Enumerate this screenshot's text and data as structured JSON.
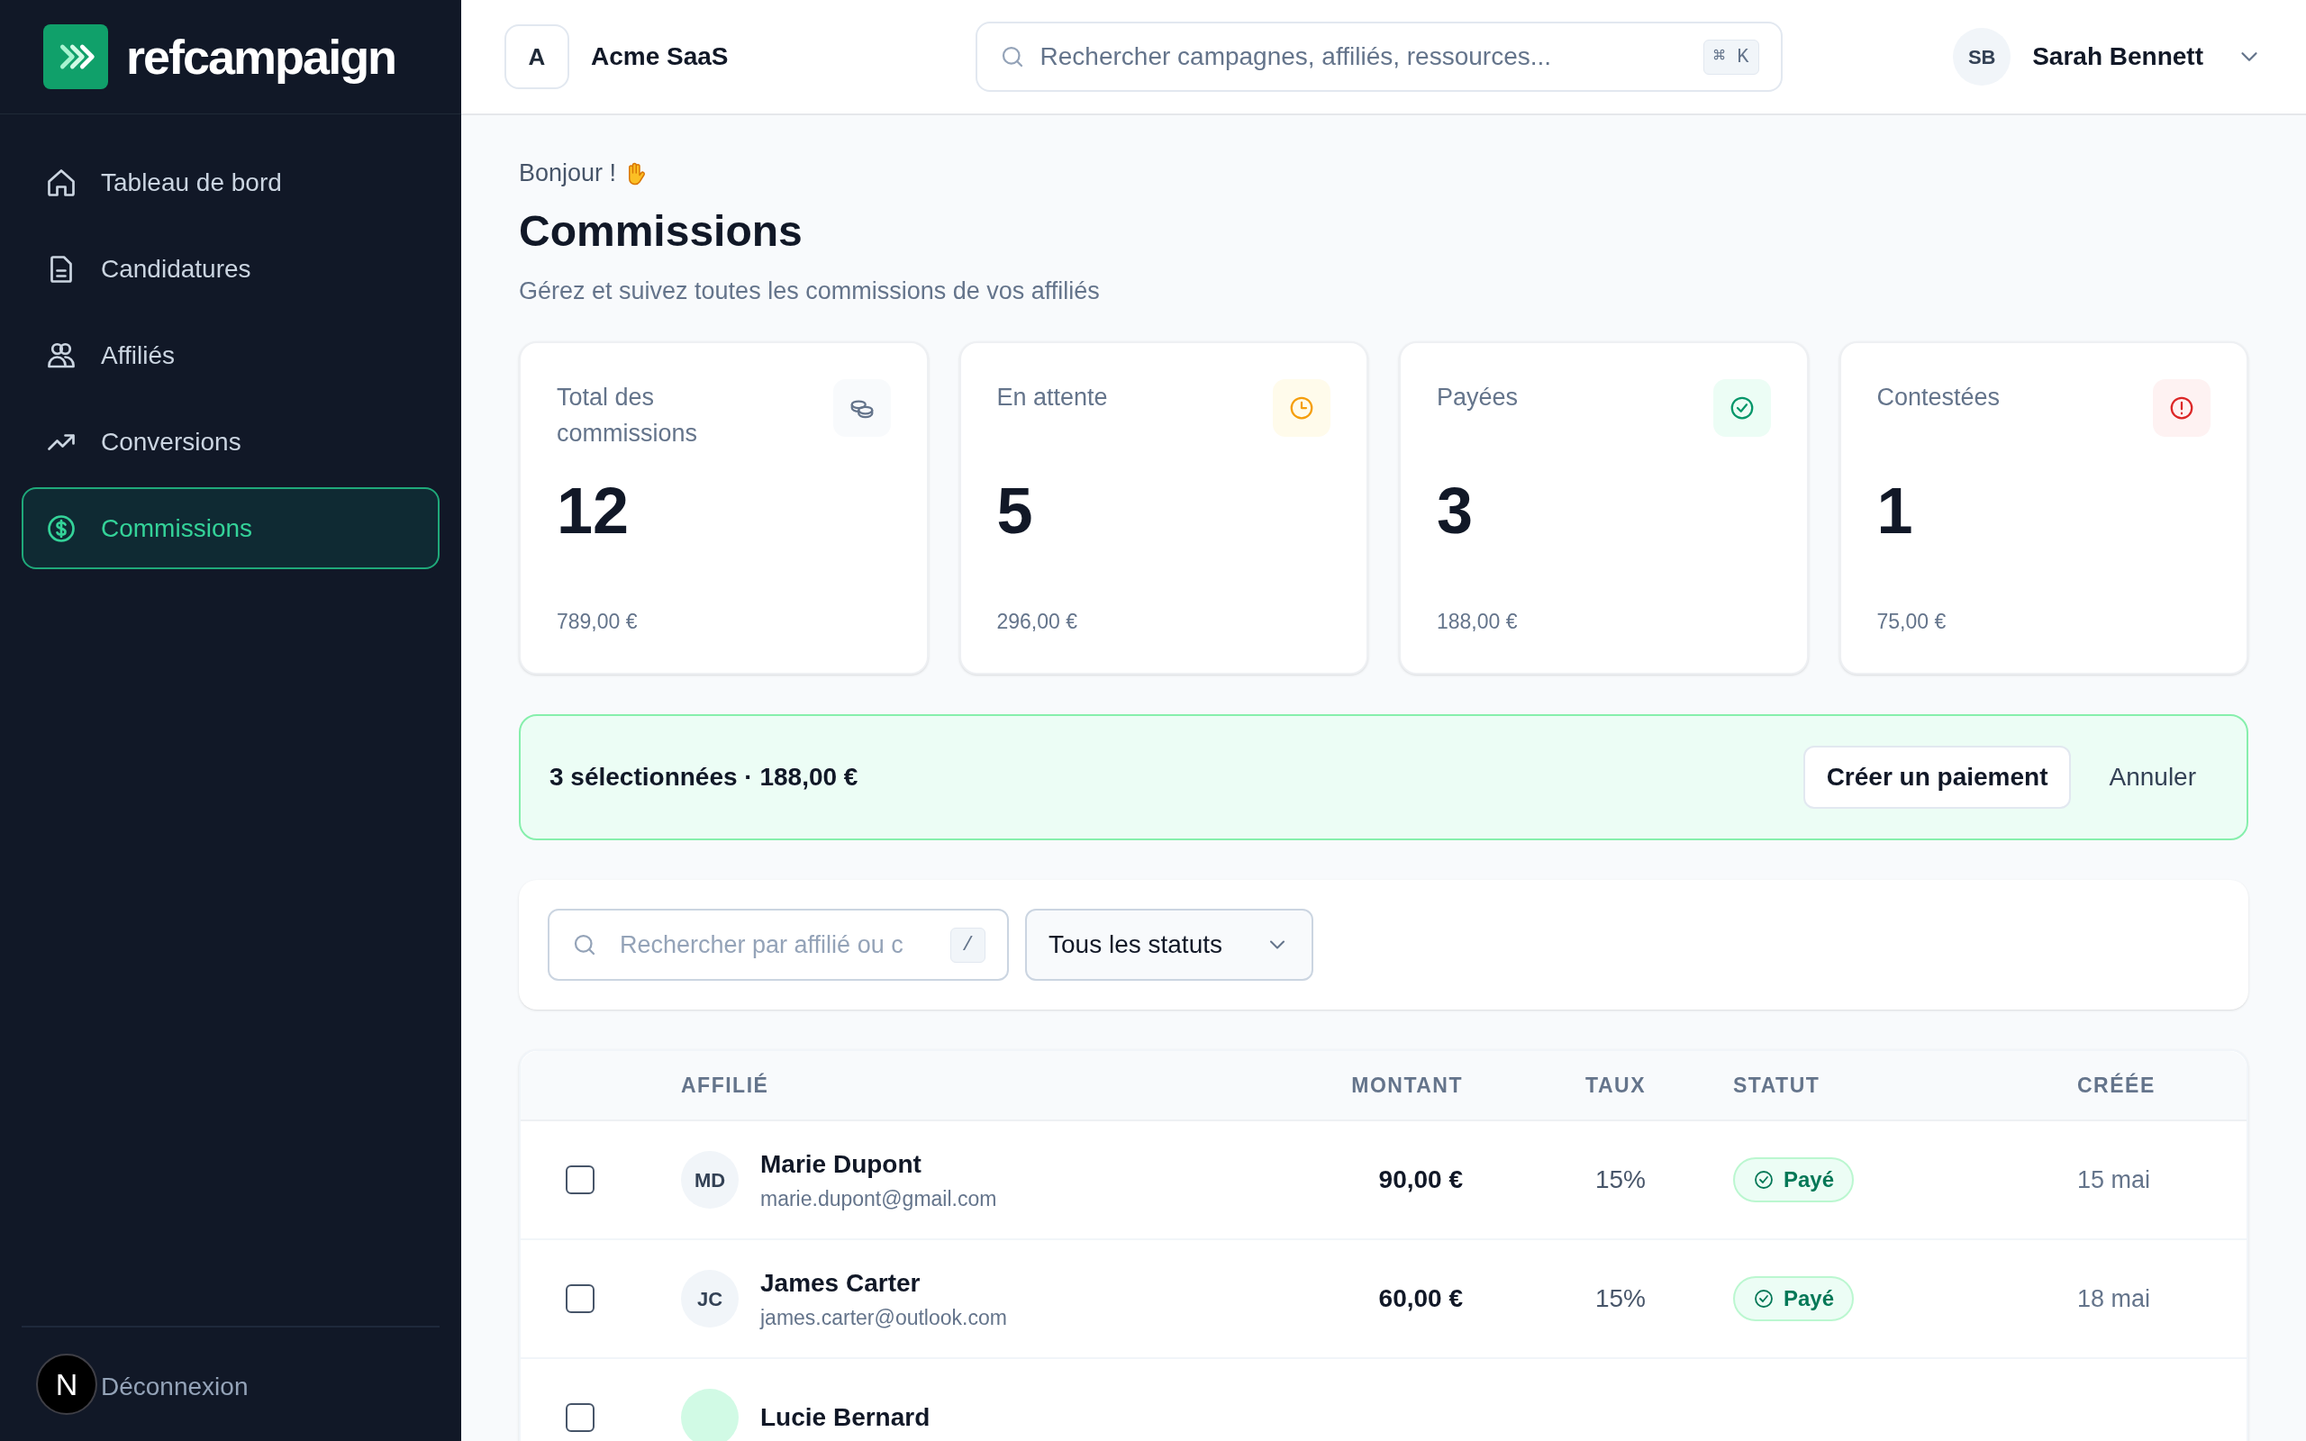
{
  "sidebar": {
    "brand": "refcampaign",
    "items": [
      {
        "label": "Tableau de bord",
        "selected": false
      },
      {
        "label": "Candidatures",
        "selected": false
      },
      {
        "label": "Affiliés",
        "selected": false
      },
      {
        "label": "Conversions",
        "selected": false
      },
      {
        "label": "Commissions",
        "selected": true
      }
    ],
    "logout": "Déconnexion",
    "dev_badge": "N"
  },
  "header": {
    "workspace_initial": "A",
    "workspace": "Acme SaaS",
    "search": {
      "placeholder": "Rechercher campagnes, affiliés, ressources...",
      "shortcut": "⌘ K"
    },
    "user_initials": "SB",
    "user_name": "Sarah Bennett"
  },
  "page": {
    "greeting": "Bonjour !",
    "title": "Commissions",
    "subtitle": "Gérez et suivez toutes les commissions de vos affiliés"
  },
  "stats": [
    {
      "label": "Total des commissions",
      "value": "12",
      "amount": "789,00 €"
    },
    {
      "label": "En attente",
      "value": "5",
      "amount": "296,00 €"
    },
    {
      "label": "Payées",
      "value": "3",
      "amount": "188,00 €"
    },
    {
      "label": "Contestées",
      "value": "1",
      "amount": "75,00 €"
    }
  ],
  "selection_bar": {
    "text": "3 sélectionnées · 188,00 €",
    "primary": "Créer un paiement",
    "cancel": "Annuler"
  },
  "filters": {
    "search": {
      "placeholder": "Rechercher par affilié ou c",
      "shortcut": "/"
    },
    "status": "Tous les statuts"
  },
  "table": {
    "columns": [
      "AFFILIÉ",
      "MONTANT",
      "TAUX",
      "STATUT",
      "CRÉÉE"
    ],
    "rows": [
      {
        "checked": false,
        "initials": "MD",
        "color": "#f1f5f9",
        "name": "Marie Dupont",
        "email": "marie.dupont@gmail.com",
        "amount": "90,00 €",
        "rate": "15%",
        "status": "Payé",
        "created": "15 mai"
      },
      {
        "checked": false,
        "initials": "JC",
        "color": "#f1f5f9",
        "name": "James Carter",
        "email": "james.carter@outlook.com",
        "amount": "60,00 €",
        "rate": "15%",
        "status": "Payé",
        "created": "18 mai"
      },
      {
        "checked": false,
        "color": "#d1fae5",
        "name": "Lucie Bernard"
      }
    ]
  }
}
